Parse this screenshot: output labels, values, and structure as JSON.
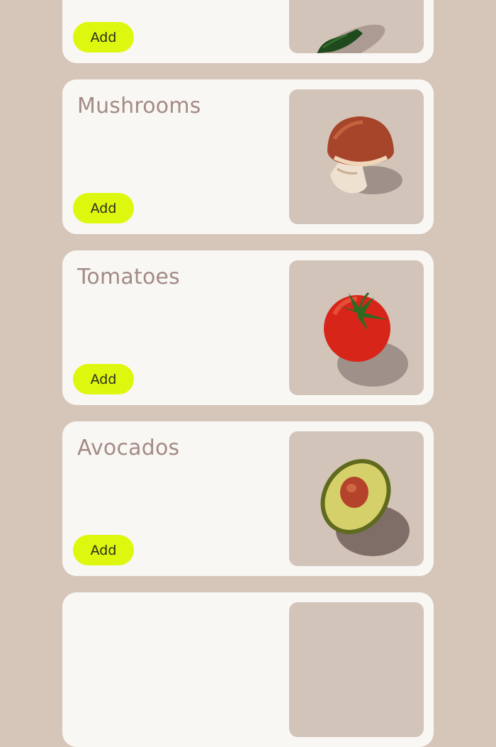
{
  "cards": [
    {
      "name": "",
      "add_label": "Add",
      "image": "jalapeno-image"
    },
    {
      "name": "Mushrooms",
      "add_label": "Add",
      "image": "mushroom-image"
    },
    {
      "name": "Tomatoes",
      "add_label": "Add",
      "image": "tomato-image"
    },
    {
      "name": "Avocados",
      "add_label": "Add",
      "image": "avocado-image"
    },
    {
      "name": "",
      "add_label": "",
      "image": ""
    }
  ],
  "colors": {
    "page_background": "#d6c5b9",
    "card_background": "#f9f7f4",
    "title_text": "#a38b85",
    "add_button": "#ddf80e",
    "image_tile": "#d3c4ba"
  }
}
